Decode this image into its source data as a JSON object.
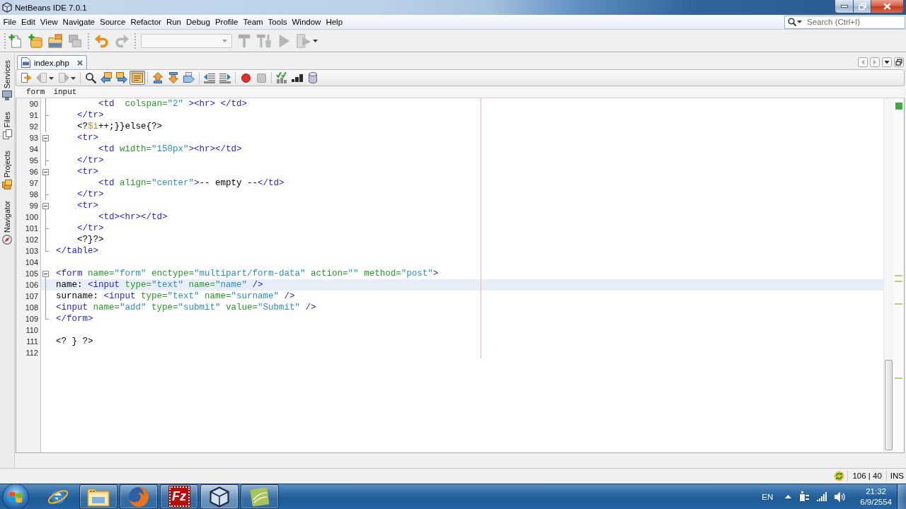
{
  "window": {
    "title": "NetBeans IDE 7.0.1"
  },
  "menu": [
    "File",
    "Edit",
    "View",
    "Navigate",
    "Source",
    "Refactor",
    "Run",
    "Debug",
    "Profile",
    "Team",
    "Tools",
    "Window",
    "Help"
  ],
  "search": {
    "placeholder": "Search (Ctrl+I)"
  },
  "toolbar": [
    [
      {
        "kind": "file",
        "disabled": false
      },
      {
        "kind": "project",
        "disabled": false
      },
      {
        "kind": "open",
        "disabled": false
      },
      {
        "kind": "close",
        "disabled": true
      }
    ],
    [
      {
        "kind": "undo",
        "disabled": false
      },
      {
        "kind": "redo",
        "disabled": true
      }
    ],
    [
      {
        "kind": "config",
        "disabled": true
      },
      {
        "kind": "build",
        "disabled": true
      },
      {
        "kind": "clean",
        "disabled": true
      },
      {
        "kind": "run",
        "disabled": true
      },
      {
        "kind": "debug",
        "disabled": true
      }
    ]
  ],
  "side_tabs": [
    {
      "label": "Services",
      "kind": "services"
    },
    {
      "label": "Files",
      "kind": "files"
    },
    {
      "label": "Projects",
      "kind": "projects"
    },
    {
      "label": "Navigator",
      "kind": "navigator"
    }
  ],
  "editor": {
    "tabs": [
      {
        "label": "index.php",
        "selected": true
      }
    ],
    "toolbar": [
      [
        {
          "kind": "recent",
          "disabled": false,
          "pressed": false
        },
        {
          "kind": "back",
          "disabled": true,
          "pressed": false
        },
        {
          "kind": "forward",
          "disabled": true,
          "pressed": false
        }
      ],
      [
        {
          "kind": "find",
          "disabled": false,
          "pressed": false
        },
        {
          "kind": "findprev",
          "disabled": false,
          "pressed": false
        },
        {
          "kind": "findnext",
          "disabled": false,
          "pressed": false
        },
        {
          "kind": "highlight",
          "disabled": false,
          "pressed": true
        }
      ],
      [
        {
          "kind": "bookmarkprev",
          "disabled": false,
          "pressed": false
        },
        {
          "kind": "bookmarknext",
          "disabled": false,
          "pressed": false
        },
        {
          "kind": "bookmark",
          "disabled": false,
          "pressed": false
        }
      ],
      [
        {
          "kind": "unindent",
          "disabled": false,
          "pressed": false
        },
        {
          "kind": "indent",
          "disabled": false,
          "pressed": false
        }
      ],
      [
        {
          "kind": "record",
          "disabled": false,
          "pressed": false
        },
        {
          "kind": "stop",
          "disabled": true,
          "pressed": false
        }
      ],
      [
        {
          "kind": "check",
          "disabled": false,
          "pressed": false
        },
        {
          "kind": "steps",
          "disabled": false,
          "pressed": false
        },
        {
          "kind": "cylinder",
          "disabled": false,
          "pressed": false
        }
      ]
    ],
    "breadcrumbs": [
      "form",
      "input"
    ],
    "lines": [
      {
        "number": "90",
        "kind": "inside",
        "current": false,
        "tokens": [
          {
            "kind": "tag",
            "text": "        <td"
          },
          {
            "kind": "attr",
            "text": "  colspan="
          },
          {
            "kind": "value",
            "text": "\"2\""
          },
          {
            "kind": "tag",
            "text": " ><hr> </td>"
          }
        ]
      },
      {
        "number": "91",
        "kind": "branch",
        "current": false,
        "tokens": [
          {
            "kind": "tag",
            "text": "    </tr>"
          }
        ]
      },
      {
        "number": "92",
        "kind": "inside",
        "current": false,
        "tokens": [
          {
            "kind": "php",
            "text": "    <?"
          },
          {
            "kind": "var",
            "text": "$i"
          },
          {
            "kind": "php",
            "text": "++;}}else{?>"
          }
        ]
      },
      {
        "number": "93",
        "kind": "start",
        "current": false,
        "tokens": [
          {
            "kind": "tag",
            "text": "    <tr>"
          }
        ]
      },
      {
        "number": "94",
        "kind": "inside",
        "current": false,
        "tokens": [
          {
            "kind": "tag",
            "text": "        <td"
          },
          {
            "kind": "attr",
            "text": " width="
          },
          {
            "kind": "value",
            "text": "\"150px\""
          },
          {
            "kind": "tag",
            "text": "><hr></td>"
          }
        ]
      },
      {
        "number": "95",
        "kind": "branch",
        "current": false,
        "tokens": [
          {
            "kind": "tag",
            "text": "    </tr>"
          }
        ]
      },
      {
        "number": "96",
        "kind": "start",
        "current": false,
        "tokens": [
          {
            "kind": "tag",
            "text": "    <tr>"
          }
        ]
      },
      {
        "number": "97",
        "kind": "inside",
        "current": false,
        "tokens": [
          {
            "kind": "tag",
            "text": "        <td"
          },
          {
            "kind": "attr",
            "text": " align="
          },
          {
            "kind": "value",
            "text": "\"center\""
          },
          {
            "kind": "tag",
            "text": ">"
          },
          {
            "kind": "text",
            "text": "-- empty --"
          },
          {
            "kind": "tag",
            "text": "</td>"
          }
        ]
      },
      {
        "number": "98",
        "kind": "branch",
        "current": false,
        "tokens": [
          {
            "kind": "tag",
            "text": "    </tr>"
          }
        ]
      },
      {
        "number": "99",
        "kind": "start",
        "current": false,
        "tokens": [
          {
            "kind": "tag",
            "text": "    <tr>"
          }
        ]
      },
      {
        "number": "100",
        "kind": "inside",
        "current": false,
        "tokens": [
          {
            "kind": "tag",
            "text": "        <td><hr></td>"
          }
        ]
      },
      {
        "number": "101",
        "kind": "branch",
        "current": false,
        "tokens": [
          {
            "kind": "tag",
            "text": "    </tr>"
          }
        ]
      },
      {
        "number": "102",
        "kind": "inside",
        "current": false,
        "tokens": [
          {
            "kind": "php",
            "text": "    <?}?>"
          }
        ]
      },
      {
        "number": "103",
        "kind": "end",
        "current": false,
        "tokens": [
          {
            "kind": "tag",
            "text": "</table>"
          }
        ]
      },
      {
        "number": "104",
        "kind": "plain",
        "current": false
      },
      {
        "number": "105",
        "kind": "start",
        "current": false,
        "tokens": [
          {
            "kind": "tag",
            "text": "<form"
          },
          {
            "kind": "attr",
            "text": " name="
          },
          {
            "kind": "value",
            "text": "\"form\""
          },
          {
            "kind": "attr",
            "text": " enctype="
          },
          {
            "kind": "value",
            "text": "\"multipart/form-data\""
          },
          {
            "kind": "attr",
            "text": " action="
          },
          {
            "kind": "value",
            "text": "\"\""
          },
          {
            "kind": "attr",
            "text": " method="
          },
          {
            "kind": "value",
            "text": "\"post\""
          },
          {
            "kind": "tag",
            "text": ">"
          }
        ]
      },
      {
        "number": "106",
        "kind": "inside",
        "current": true,
        "tokens": [
          {
            "kind": "text",
            "text": "name: "
          },
          {
            "kind": "tag",
            "text": "<input"
          },
          {
            "kind": "attr",
            "text": " type="
          },
          {
            "kind": "value",
            "text": "\"text\""
          },
          {
            "kind": "attr",
            "text": " name="
          },
          {
            "kind": "value",
            "text": "\"name\""
          },
          {
            "kind": "tag",
            "text": " />"
          }
        ]
      },
      {
        "number": "107",
        "kind": "inside",
        "current": false,
        "tokens": [
          {
            "kind": "text",
            "text": "surname: "
          },
          {
            "kind": "tag",
            "text": "<input"
          },
          {
            "kind": "attr",
            "text": " type="
          },
          {
            "kind": "value",
            "text": "\"text\""
          },
          {
            "kind": "attr",
            "text": " name="
          },
          {
            "kind": "value",
            "text": "\"surname\""
          },
          {
            "kind": "tag",
            "text": " />"
          }
        ]
      },
      {
        "number": "108",
        "kind": "inside",
        "current": false,
        "tokens": [
          {
            "kind": "tag",
            "text": "<input"
          },
          {
            "kind": "attr",
            "text": " name="
          },
          {
            "kind": "value",
            "text": "\"add\""
          },
          {
            "kind": "attr",
            "text": " type="
          },
          {
            "kind": "value",
            "text": "\"submit\""
          },
          {
            "kind": "attr",
            "text": " value="
          },
          {
            "kind": "value",
            "text": "\"Submit\""
          },
          {
            "kind": "tag",
            "text": " />"
          }
        ]
      },
      {
        "number": "109",
        "kind": "end",
        "current": false,
        "tokens": [
          {
            "kind": "tag",
            "text": "</form>"
          }
        ]
      },
      {
        "number": "110",
        "kind": "plain",
        "current": false
      },
      {
        "number": "111",
        "kind": "plain",
        "current": false,
        "tokens": [
          {
            "kind": "php",
            "text": "<? } ?>"
          }
        ]
      },
      {
        "number": "112",
        "kind": "plain",
        "current": false
      }
    ]
  },
  "status": {
    "position": "106 | 40",
    "mode": "INS"
  },
  "taskbar": {
    "apps": [
      {
        "kind": "ring",
        "running": false,
        "selected": false
      },
      {
        "kind": "folder",
        "running": true,
        "selected": false
      },
      {
        "kind": "globe",
        "running": true,
        "selected": false
      },
      {
        "kind": "ftp",
        "glyph": "Fz",
        "running": true,
        "selected": false
      },
      {
        "kind": "cube",
        "running": true,
        "selected": true
      },
      {
        "kind": "leaf",
        "running": true,
        "selected": false
      }
    ],
    "tray": {
      "language": "EN",
      "time": "21:32",
      "date": "6/9/2554"
    }
  }
}
